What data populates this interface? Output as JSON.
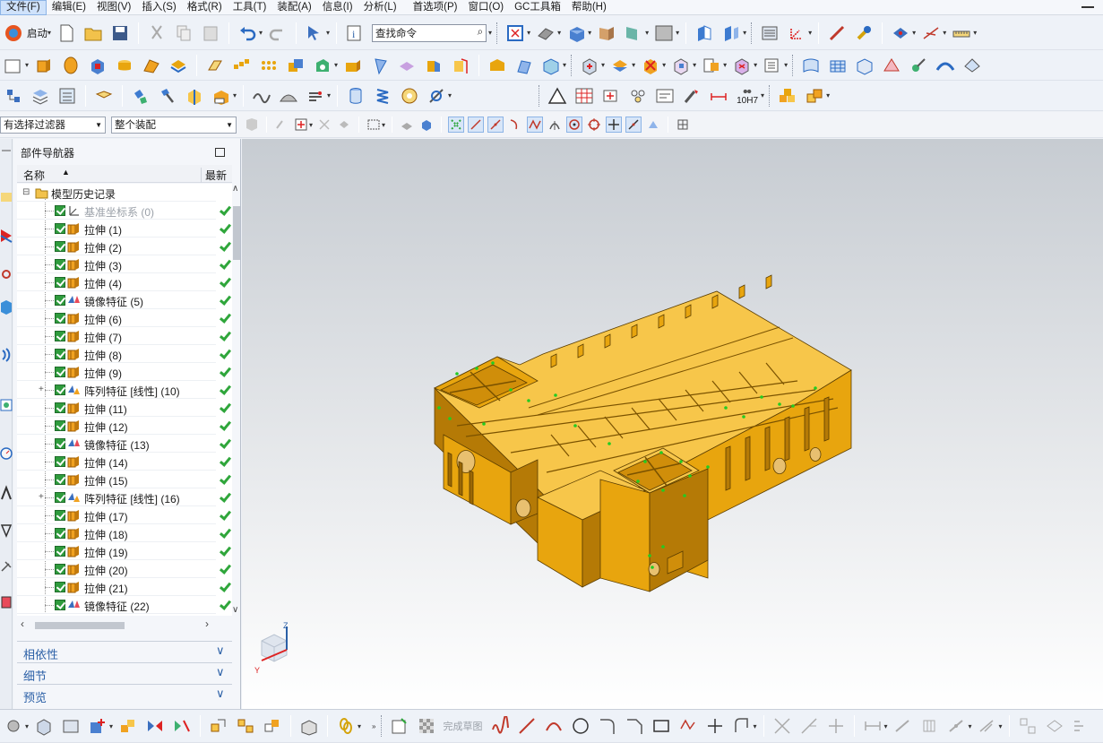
{
  "menu": {
    "items": [
      "文件(F)",
      "编辑(E)",
      "视图(V)",
      "插入(S)",
      "格式(R)",
      "工具(T)",
      "装配(A)",
      "信息(I)",
      "分析(L)",
      "首选项(P)",
      "窗口(O)",
      "GC工具箱",
      "帮助(H)"
    ],
    "active_index": 0
  },
  "toolbar": {
    "start_label": "启动",
    "search_placeholder": "查找命令",
    "selection_filter": "有选择过滤器",
    "assembly_scope": "整个装配",
    "tolerance_label": "10H7"
  },
  "navigator": {
    "title": "部件导航器",
    "col_name": "名称",
    "col_latest": "最新",
    "root": "模型历史记录",
    "features": [
      {
        "label": "基准坐标系 (0)",
        "kind": "datum",
        "dim": true,
        "expand": false
      },
      {
        "label": "拉伸 (1)",
        "kind": "extrude",
        "dim": false,
        "expand": false
      },
      {
        "label": "拉伸 (2)",
        "kind": "extrude",
        "dim": false,
        "expand": false
      },
      {
        "label": "拉伸 (3)",
        "kind": "extrude",
        "dim": false,
        "expand": false
      },
      {
        "label": "拉伸 (4)",
        "kind": "extrude",
        "dim": false,
        "expand": false
      },
      {
        "label": "镜像特征 (5)",
        "kind": "mirror",
        "dim": false,
        "expand": false
      },
      {
        "label": "拉伸 (6)",
        "kind": "extrude",
        "dim": false,
        "expand": false
      },
      {
        "label": "拉伸 (7)",
        "kind": "extrude",
        "dim": false,
        "expand": false
      },
      {
        "label": "拉伸 (8)",
        "kind": "extrude",
        "dim": false,
        "expand": false
      },
      {
        "label": "拉伸 (9)",
        "kind": "extrude",
        "dim": false,
        "expand": false
      },
      {
        "label": "阵列特征 [线性] (10)",
        "kind": "pattern",
        "dim": false,
        "expand": true
      },
      {
        "label": "拉伸 (11)",
        "kind": "extrude",
        "dim": false,
        "expand": false
      },
      {
        "label": "拉伸 (12)",
        "kind": "extrude",
        "dim": false,
        "expand": false
      },
      {
        "label": "镜像特征 (13)",
        "kind": "mirror",
        "dim": false,
        "expand": false
      },
      {
        "label": "拉伸 (14)",
        "kind": "extrude",
        "dim": false,
        "expand": false
      },
      {
        "label": "拉伸 (15)",
        "kind": "extrude",
        "dim": false,
        "expand": false
      },
      {
        "label": "阵列特征 [线性] (16)",
        "kind": "pattern",
        "dim": false,
        "expand": true
      },
      {
        "label": "拉伸 (17)",
        "kind": "extrude",
        "dim": false,
        "expand": false
      },
      {
        "label": "拉伸 (18)",
        "kind": "extrude",
        "dim": false,
        "expand": false
      },
      {
        "label": "拉伸 (19)",
        "kind": "extrude",
        "dim": false,
        "expand": false
      },
      {
        "label": "拉伸 (20)",
        "kind": "extrude",
        "dim": false,
        "expand": false
      },
      {
        "label": "拉伸 (21)",
        "kind": "extrude",
        "dim": false,
        "expand": false
      },
      {
        "label": "镜像特征 (22)",
        "kind": "mirror",
        "dim": false,
        "expand": false
      }
    ],
    "panels": [
      "相依性",
      "细节",
      "预览"
    ]
  },
  "bottom": {
    "finish_sketch": "完成草图"
  },
  "triad": {
    "z": "Z",
    "y": "Y"
  },
  "colors": {
    "model": "#e8a50e",
    "model_dark": "#b57a06",
    "model_light": "#f7c64a",
    "accent": "#2a5fa6"
  }
}
